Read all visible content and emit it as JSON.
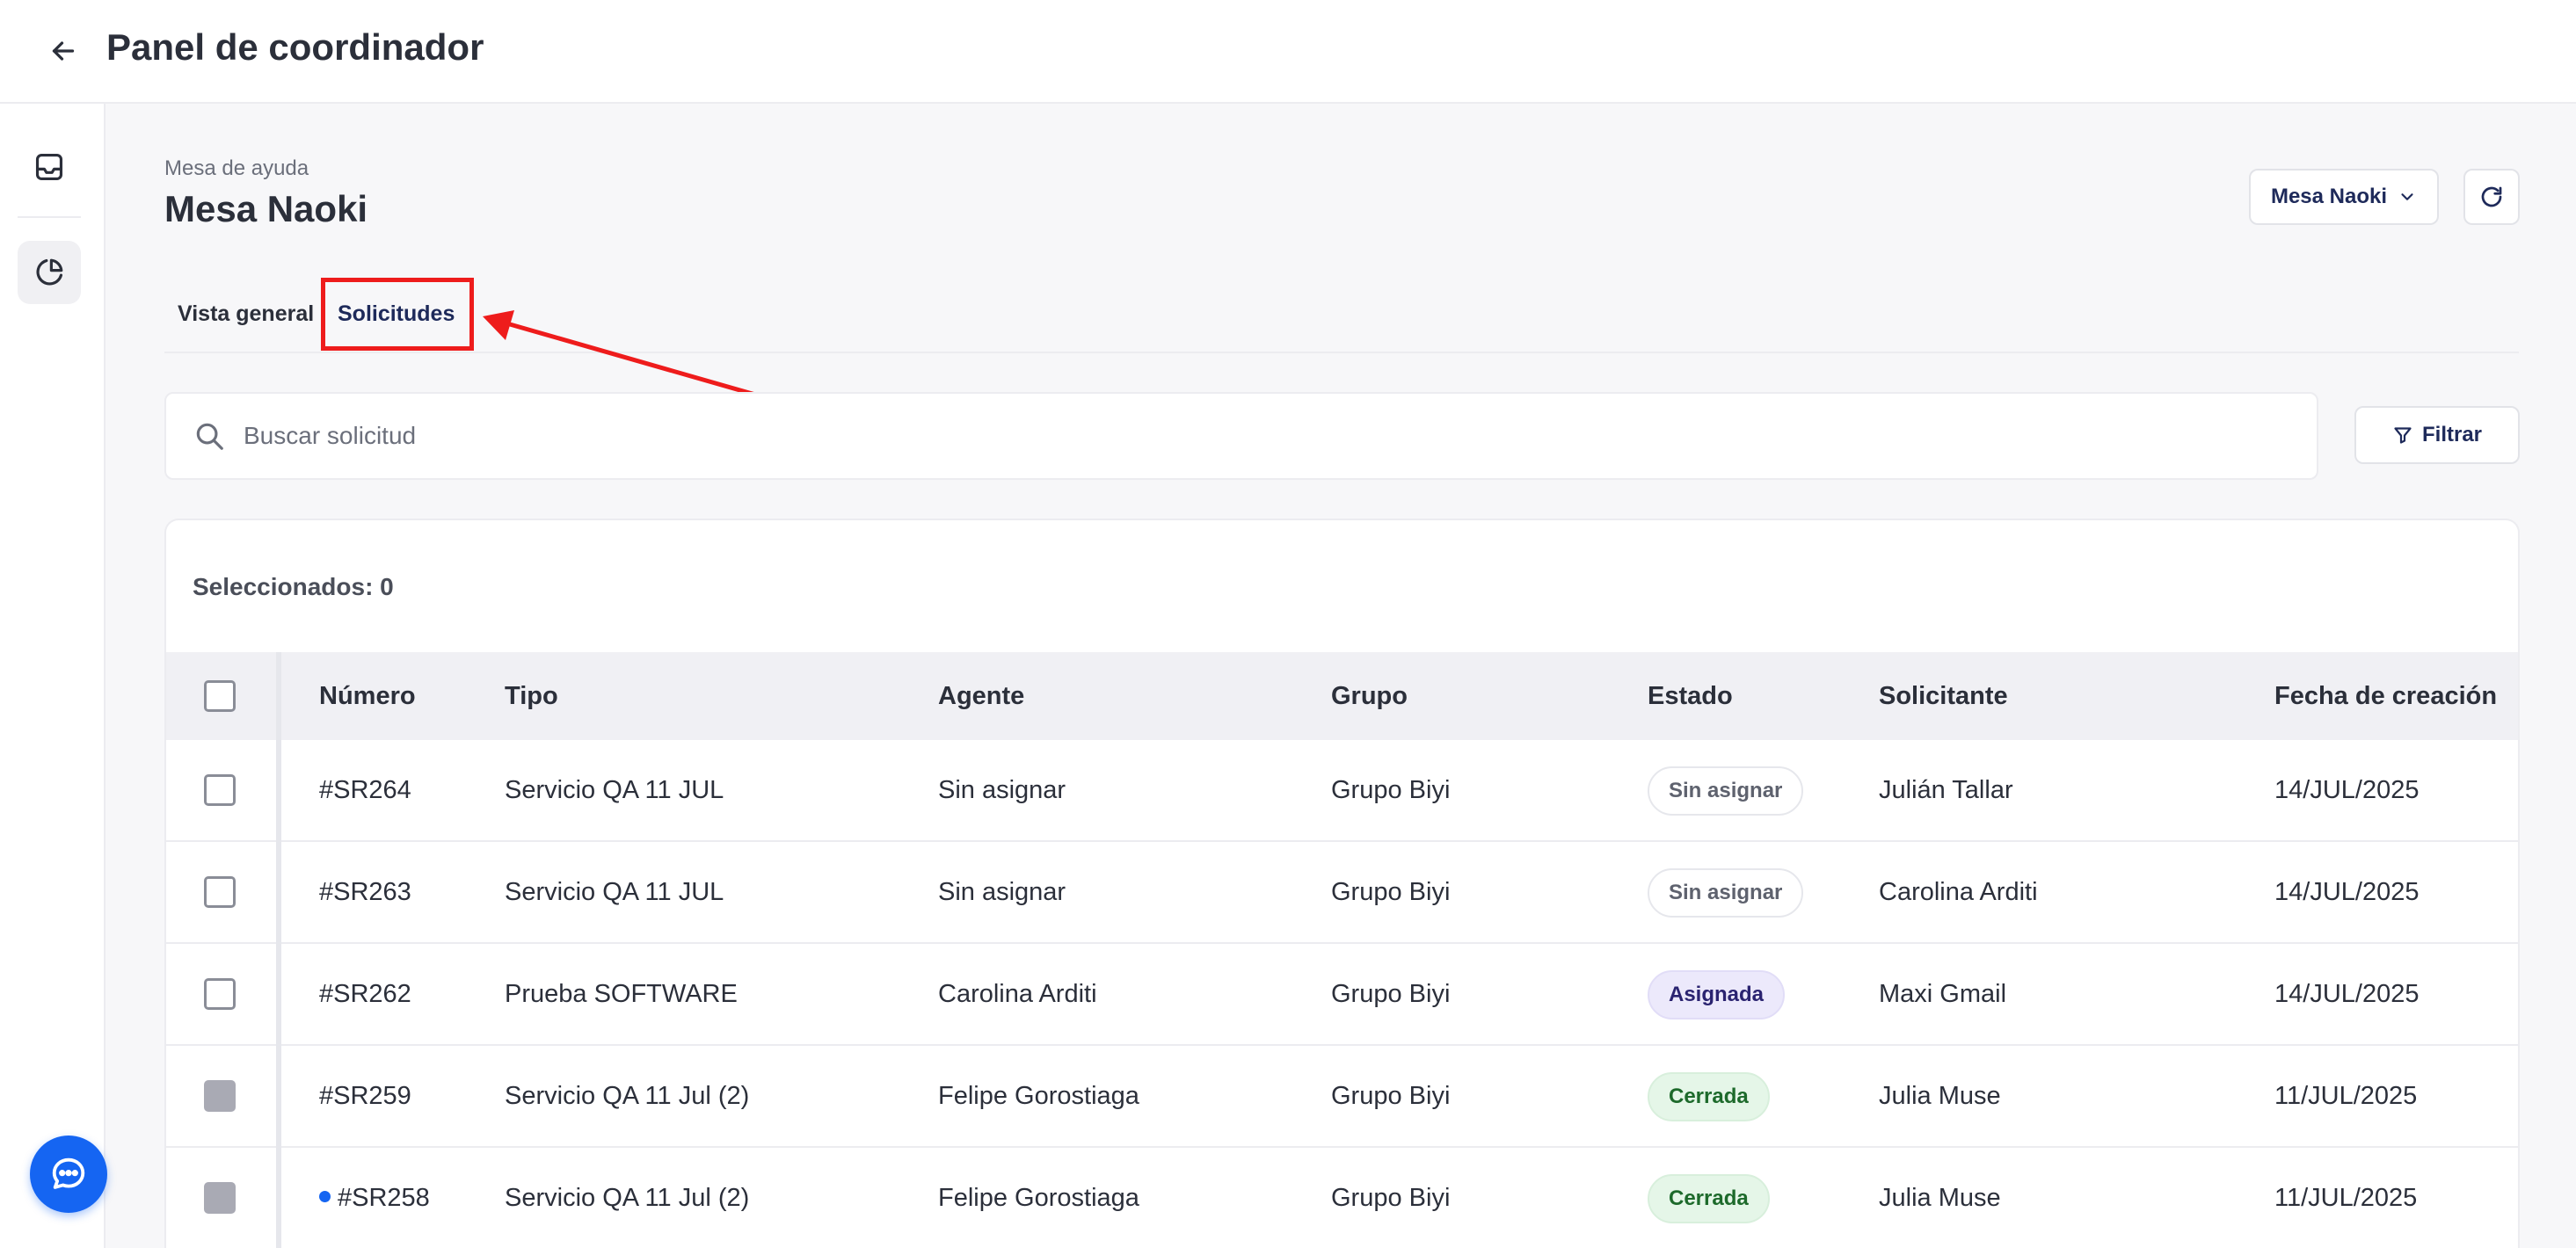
{
  "header": {
    "title": "Panel de coordinador"
  },
  "sidebar": {
    "items": [
      {
        "icon": "inbox-icon"
      },
      {
        "icon": "pie-chart-icon",
        "active": true
      }
    ]
  },
  "page": {
    "breadcrumb": "Mesa de ayuda",
    "title": "Mesa Naoki",
    "desk_selector": {
      "value": "Mesa Naoki"
    }
  },
  "tabs": [
    {
      "label": "Vista general",
      "active": false
    },
    {
      "label": "Solicitudes",
      "active": true
    }
  ],
  "search": {
    "placeholder": "Buscar solicitud"
  },
  "filter": {
    "label": "Filtrar"
  },
  "table": {
    "selected_label": "Seleccionados: 0",
    "columns": [
      "Número",
      "Tipo",
      "Agente",
      "Grupo",
      "Estado",
      "Solicitante",
      "Fecha de creación"
    ],
    "rows": [
      {
        "numero": "#SR264",
        "tipo": "Servicio QA 11 JUL",
        "agente": "Sin asignar",
        "grupo": "Grupo Biyi",
        "estado": "Sin asignar",
        "estado_kind": "unassigned",
        "solicitante": "Julián Tallar",
        "fecha": "14/JUL/2025",
        "checkbox_disabled": false,
        "unread": false
      },
      {
        "numero": "#SR263",
        "tipo": "Servicio QA 11 JUL",
        "agente": "Sin asignar",
        "grupo": "Grupo Biyi",
        "estado": "Sin asignar",
        "estado_kind": "unassigned",
        "solicitante": "Carolina Arditi",
        "fecha": "14/JUL/2025",
        "checkbox_disabled": false,
        "unread": false
      },
      {
        "numero": "#SR262",
        "tipo": "Prueba SOFTWARE",
        "agente": "Carolina Arditi",
        "grupo": "Grupo Biyi",
        "estado": "Asignada",
        "estado_kind": "assigned",
        "solicitante": "Maxi Gmail",
        "fecha": "14/JUL/2025",
        "checkbox_disabled": false,
        "unread": false
      },
      {
        "numero": "#SR259",
        "tipo": "Servicio QA 11 Jul (2)",
        "agente": "Felipe Gorostiaga",
        "grupo": "Grupo Biyi",
        "estado": "Cerrada",
        "estado_kind": "closed",
        "solicitante": "Julia Muse",
        "fecha": "11/JUL/2025",
        "checkbox_disabled": true,
        "unread": false
      },
      {
        "numero": "#SR258",
        "tipo": "Servicio QA 11 Jul (2)",
        "agente": "Felipe Gorostiaga",
        "grupo": "Grupo Biyi",
        "estado": "Cerrada",
        "estado_kind": "closed",
        "solicitante": "Julia Muse",
        "fecha": "11/JUL/2025",
        "checkbox_disabled": true,
        "unread": true
      }
    ]
  },
  "colors": {
    "accent": "#1565f2",
    "annotation": "#ee1c1c",
    "badge_assigned": "#ece9fb",
    "badge_closed": "#e5f6e8"
  }
}
